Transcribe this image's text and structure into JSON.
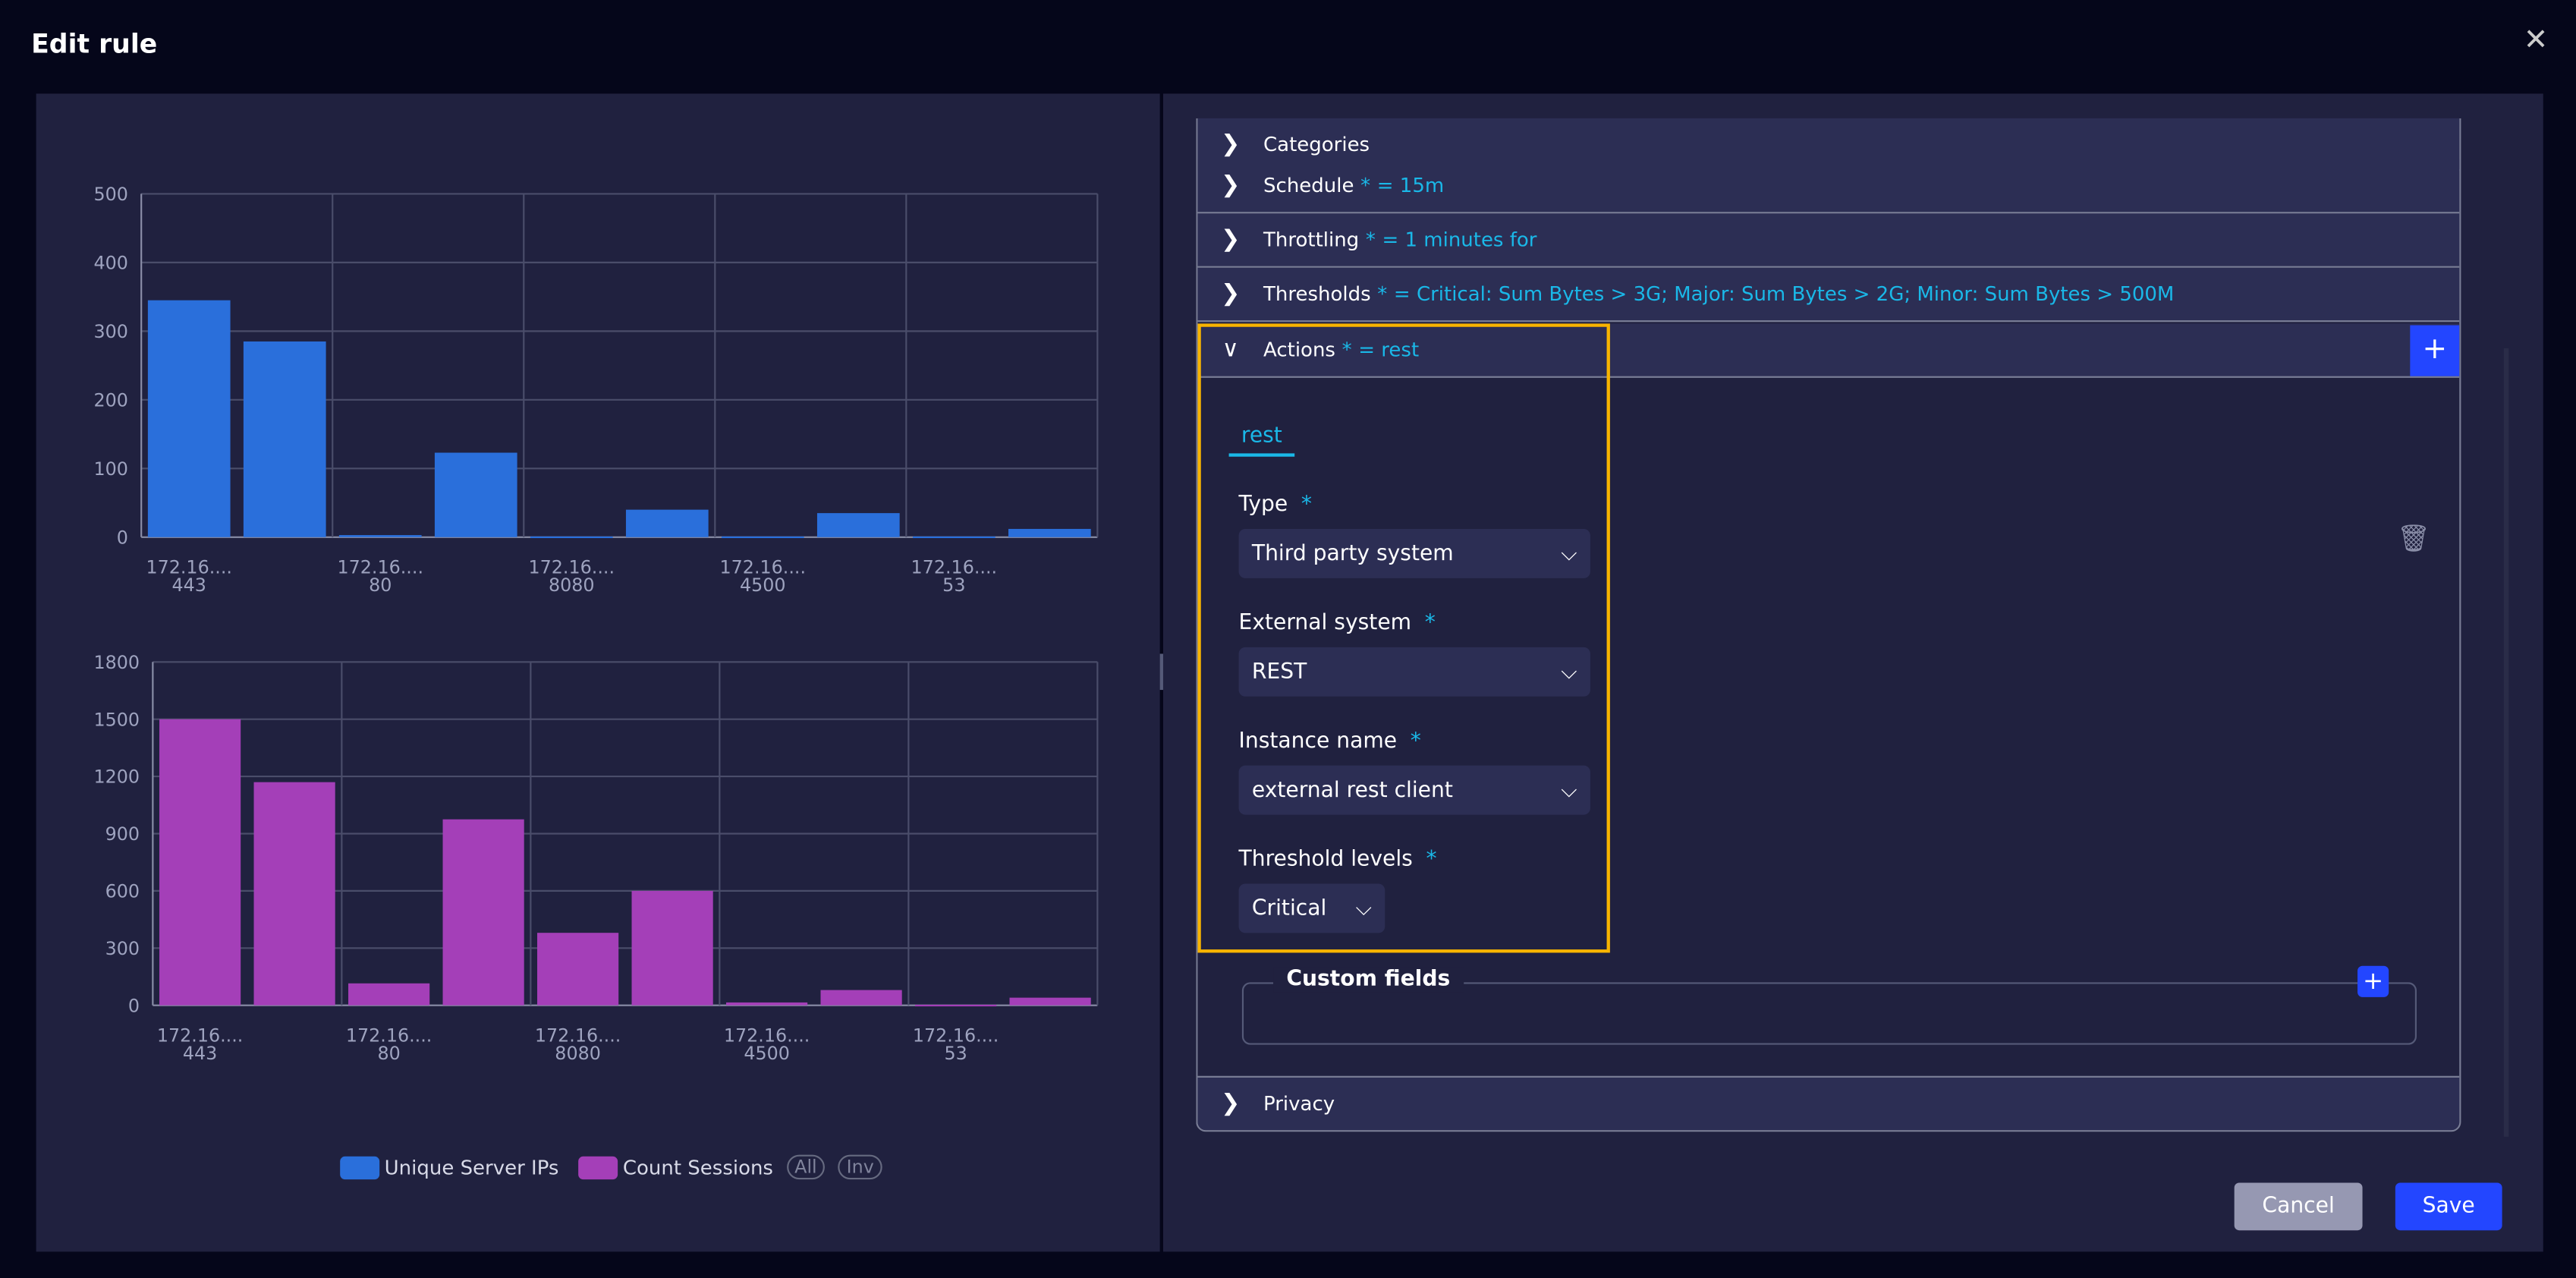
{
  "dialog": {
    "title": "Edit rule",
    "close_icon": "close-icon"
  },
  "chart_data": [
    {
      "type": "bar",
      "categories": [
        "172.16....\n443",
        "",
        "172.16....\n80",
        "",
        "172.16....\n8080",
        "",
        "172.16....\n4500",
        "",
        "172.16....\n53",
        ""
      ],
      "x_tick_labels": [
        [
          "172.16....",
          "443"
        ],
        [
          "172.16....",
          "80"
        ],
        [
          "172.16....",
          "8080"
        ],
        [
          "172.16....",
          "4500"
        ],
        [
          "172.16....",
          "53"
        ]
      ],
      "series": [
        {
          "name": "Unique Server IPs",
          "values": [
            345,
            285,
            3,
            123,
            1,
            40,
            1,
            35,
            1,
            12
          ]
        }
      ],
      "y_ticks": [
        0,
        100,
        200,
        300,
        400,
        500
      ],
      "ylim": [
        0,
        500
      ],
      "grid": true,
      "color": "#2a6fdb"
    },
    {
      "type": "bar",
      "x_tick_labels": [
        [
          "172.16....",
          "443"
        ],
        [
          "172.16....",
          "80"
        ],
        [
          "172.16....",
          "8080"
        ],
        [
          "172.16....",
          "4500"
        ],
        [
          "172.16....",
          "53"
        ]
      ],
      "series": [
        {
          "name": "Count Sessions",
          "values": [
            1500,
            1170,
            115,
            975,
            380,
            600,
            15,
            80,
            3,
            40
          ]
        }
      ],
      "y_ticks": [
        0,
        300,
        600,
        900,
        1200,
        1500,
        1800
      ],
      "ylim": [
        0,
        1800
      ],
      "grid": true,
      "color": "#a43fb8"
    }
  ],
  "legend": {
    "items": [
      {
        "label": "Unique Server IPs",
        "color": "#2a6fdb"
      },
      {
        "label": "Count Sessions",
        "color": "#a43fb8"
      }
    ],
    "all": "All",
    "inv": "Inv",
    "placement": "bottom"
  },
  "sections": {
    "categories": {
      "label": "Categories"
    },
    "schedule": {
      "label": "Schedule",
      "req": "*",
      "value": "= 15m"
    },
    "throttling": {
      "label": "Throttling",
      "req": "*",
      "value": "= 1 minutes for"
    },
    "thresholds": {
      "label": "Thresholds",
      "req": "*",
      "value": "= Critical: Sum Bytes > 3G; Major: Sum Bytes > 2G; Minor: Sum Bytes > 500M"
    },
    "actions": {
      "label": "Actions",
      "req": "*",
      "value": "= rest"
    },
    "privacy": {
      "label": "Privacy"
    }
  },
  "action": {
    "tab": "rest",
    "type": {
      "label": "Type",
      "req": "*",
      "value": "Third party system"
    },
    "external": {
      "label": "External system",
      "req": "*",
      "value": "REST"
    },
    "instance": {
      "label": "Instance name",
      "req": "*",
      "value": "external rest client"
    },
    "levels": {
      "label": "Threshold levels",
      "req": "*",
      "value": "Critical"
    },
    "custom_fields": "Custom fields"
  },
  "footer": {
    "cancel": "Cancel",
    "save": "Save"
  }
}
